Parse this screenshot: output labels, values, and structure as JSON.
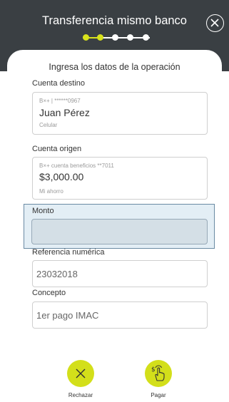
{
  "header": {
    "title": "Transferencia mismo banco",
    "steps_total": 5,
    "current_step": 2
  },
  "form": {
    "subtitle": "Ingresa los datos de la operación",
    "cuenta_destino": {
      "label": "Cuenta destino",
      "account_line": "B×+ | ******0967",
      "name": "Juan Pérez",
      "type": "Celular"
    },
    "cuenta_origen": {
      "label": "Cuenta origen",
      "account_line": "B×+ cuenta beneficios **7011",
      "balance": "$3,000.00",
      "alias": "Mi ahorro"
    },
    "monto": {
      "label": "Monto",
      "value": ""
    },
    "referencia": {
      "label": "Referencia numérica",
      "value": "23032018"
    },
    "concepto": {
      "label": "Concepto",
      "value": "1er pago IMAC"
    }
  },
  "actions": {
    "reject_label": "Rechazar",
    "pay_label": "Pagar"
  },
  "colors": {
    "header_bg": "#3a3f43",
    "accent": "#d3df1a",
    "monto_highlight": "#e3eef5"
  }
}
